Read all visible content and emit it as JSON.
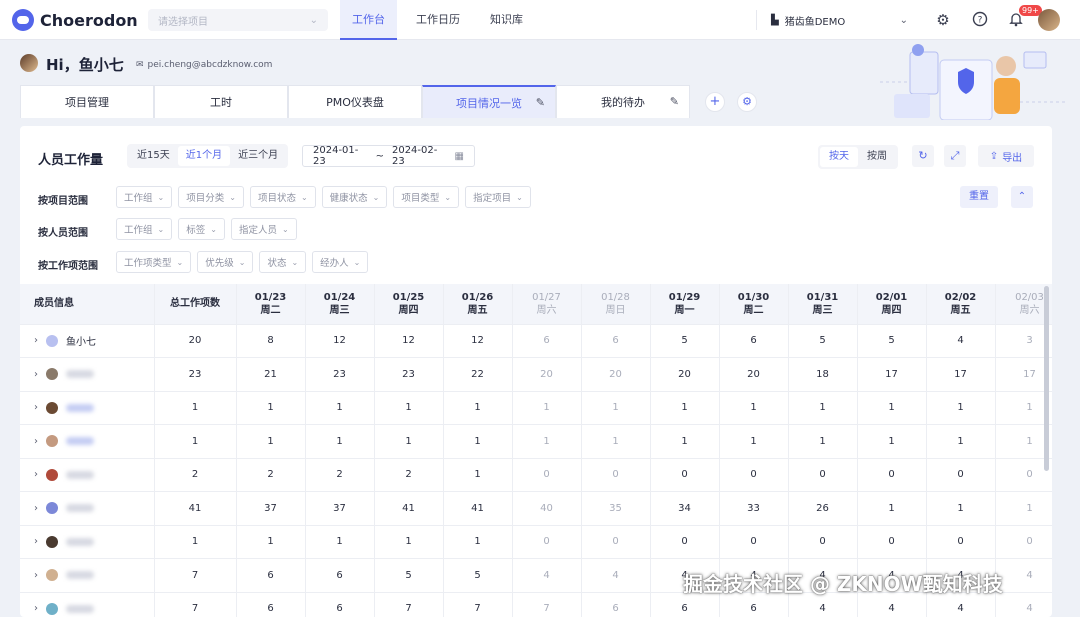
{
  "app": {
    "name": "Choerodon",
    "project_placeholder": "请选择项目"
  },
  "nav": {
    "tabs": [
      "工作台",
      "工作日历",
      "知识库"
    ],
    "active": 0
  },
  "org": {
    "name": "猪齿鱼DEMO"
  },
  "notifications": {
    "count": "99+"
  },
  "user": {
    "greeting": "Hi，鱼小七",
    "email": "pei.cheng@abcdzknow.com"
  },
  "tabs": [
    {
      "label": "项目管理",
      "active": false,
      "editable": false
    },
    {
      "label": "工时",
      "active": false,
      "editable": false
    },
    {
      "label": "PMO仪表盘",
      "active": false,
      "editable": false
    },
    {
      "label": "项目情况一览",
      "active": true,
      "editable": true
    },
    {
      "label": "我的待办",
      "active": false,
      "editable": true
    }
  ],
  "card": {
    "title": "人员工作量",
    "ranges": [
      "近15天",
      "近1个月",
      "近三个月"
    ],
    "active_range": 1,
    "date_start": "2024-01-23",
    "date_sep": "~",
    "date_end": "2024-02-23",
    "granularity": [
      "按天",
      "按周"
    ],
    "active_granularity": 0,
    "export_label": "导出",
    "reset_label": "重置"
  },
  "filters": [
    {
      "label": "按项目范围",
      "chips": [
        "工作组",
        "项目分类",
        "项目状态",
        "健康状态",
        "项目类型",
        "指定项目"
      ]
    },
    {
      "label": "按人员范围",
      "chips": [
        "工作组",
        "标签",
        "指定人员"
      ]
    },
    {
      "label": "按工作项范围",
      "chips": [
        "工作项类型",
        "优先级",
        "状态",
        "经办人"
      ]
    }
  ],
  "table": {
    "member_header": "成员信息",
    "total_header": "总工作项数",
    "days": [
      {
        "date": "01/23",
        "weekday": "周二",
        "weekend": false
      },
      {
        "date": "01/24",
        "weekday": "周三",
        "weekend": false
      },
      {
        "date": "01/25",
        "weekday": "周四",
        "weekend": false
      },
      {
        "date": "01/26",
        "weekday": "周五",
        "weekend": false
      },
      {
        "date": "01/27",
        "weekday": "周六",
        "weekend": true
      },
      {
        "date": "01/28",
        "weekday": "周日",
        "weekend": true
      },
      {
        "date": "01/29",
        "weekday": "周一",
        "weekend": false
      },
      {
        "date": "01/30",
        "weekday": "周二",
        "weekend": false
      },
      {
        "date": "01/31",
        "weekday": "周三",
        "weekend": false
      },
      {
        "date": "02/01",
        "weekday": "周四",
        "weekend": false
      },
      {
        "date": "02/02",
        "weekday": "周五",
        "weekend": false
      },
      {
        "date": "02/03",
        "weekday": "周六",
        "weekend": true
      }
    ],
    "rows": [
      {
        "name": "鱼小七",
        "avatar": "#b8c0f0",
        "blur": "",
        "total": 20,
        "values": [
          8,
          12,
          12,
          12,
          6,
          6,
          5,
          6,
          5,
          5,
          4,
          3
        ]
      },
      {
        "name": "",
        "avatar": "#8a7a6a",
        "blur": "gray",
        "total": 23,
        "values": [
          21,
          23,
          23,
          22,
          20,
          20,
          20,
          20,
          18,
          17,
          17,
          17
        ]
      },
      {
        "name": "",
        "avatar": "#6b4a33",
        "blur": "blue",
        "total": 1,
        "values": [
          1,
          1,
          1,
          1,
          1,
          1,
          1,
          1,
          1,
          1,
          1,
          1
        ]
      },
      {
        "name": "",
        "avatar": "#c49a80",
        "blur": "blue",
        "total": 1,
        "values": [
          1,
          1,
          1,
          1,
          1,
          1,
          1,
          1,
          1,
          1,
          1,
          1
        ]
      },
      {
        "name": "",
        "avatar": "#b04a3a",
        "blur": "gray",
        "total": 2,
        "values": [
          2,
          2,
          2,
          1,
          0,
          0,
          0,
          0,
          0,
          0,
          0,
          0
        ]
      },
      {
        "name": "",
        "avatar": "#7c88d8",
        "blur": "gray",
        "total": 41,
        "values": [
          37,
          37,
          41,
          41,
          40,
          35,
          34,
          33,
          26,
          1,
          1,
          1
        ]
      },
      {
        "name": "",
        "avatar": "#4a3a30",
        "blur": "gray",
        "total": 1,
        "values": [
          1,
          1,
          1,
          1,
          0,
          0,
          0,
          0,
          0,
          0,
          0,
          0
        ]
      },
      {
        "name": "",
        "avatar": "#d0b090",
        "blur": "gray",
        "total": 7,
        "values": [
          6,
          6,
          5,
          5,
          4,
          4,
          4,
          4,
          4,
          4,
          4,
          4
        ]
      },
      {
        "name": "",
        "avatar": "#6fb0c8",
        "blur": "gray",
        "total": 7,
        "values": [
          6,
          6,
          7,
          7,
          7,
          6,
          6,
          6,
          4,
          4,
          4,
          4
        ]
      }
    ]
  },
  "watermark": "掘金技术社区 @ ZKNOW甄知科技",
  "colors": {
    "accent": "#5365ea",
    "bg": "#eef1f7"
  }
}
